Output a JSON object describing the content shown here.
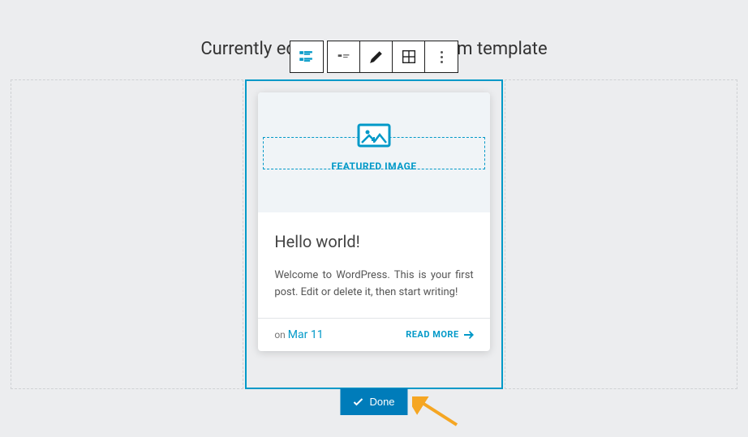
{
  "heading": "Currently editing the \"Default\" item template",
  "featured": {
    "label": "FEATURED IMAGE"
  },
  "post": {
    "title": "Hello world!",
    "excerpt": "Welcome to WordPress. This is your first post. Edit or delete it, then start writing!",
    "date_prefix": "on",
    "date": "Mar 11",
    "readmore": "READ MORE"
  },
  "done": "Done"
}
